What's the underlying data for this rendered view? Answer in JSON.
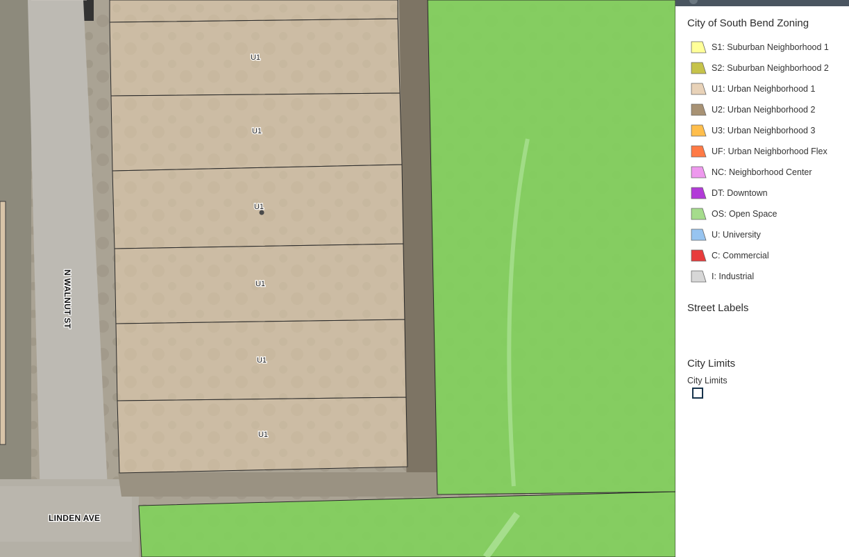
{
  "map": {
    "parcels": [
      {
        "label": "U1"
      },
      {
        "label": "U1"
      },
      {
        "label": "U1"
      },
      {
        "label": "U1"
      },
      {
        "label": "U1"
      },
      {
        "label": "U1"
      }
    ],
    "streets": {
      "walnut": "N WALNUT ST",
      "linden": "LINDEN AVE"
    },
    "colors": {
      "u1_fill": "#e8d2b0",
      "os_fill": "#7fd35a",
      "parcel_stroke": "#2a2a2a"
    }
  },
  "legend": {
    "layer_title": "City of South Bend Zoning",
    "items": [
      {
        "label": "S1: Suburban Neighborhood 1",
        "color": "#ffff99",
        "icon": "polygon-swatch-icon"
      },
      {
        "label": "S2: Suburban Neighborhood 2",
        "color": "#c6c34a",
        "icon": "polygon-swatch-icon"
      },
      {
        "label": "U1: Urban Neighborhood 1",
        "color": "#e8d2b8",
        "icon": "polygon-swatch-icon"
      },
      {
        "label": "U2: Urban Neighborhood 2",
        "color": "#a89274",
        "icon": "polygon-swatch-icon"
      },
      {
        "label": "U3: Urban Neighborhood 3",
        "color": "#ffbe4c",
        "icon": "polygon-swatch-icon"
      },
      {
        "label": "UF: Urban Neighborhood Flex",
        "color": "#ff7a45",
        "icon": "polygon-swatch-icon"
      },
      {
        "label": "NC: Neighborhood Center",
        "color": "#ee99ee",
        "icon": "polygon-swatch-icon"
      },
      {
        "label": "DT: Downtown",
        "color": "#b23ad8",
        "icon": "polygon-swatch-icon"
      },
      {
        "label": "OS: Open Space",
        "color": "#a5dc8c",
        "icon": "polygon-swatch-icon"
      },
      {
        "label": "U: University",
        "color": "#97c4f0",
        "icon": "polygon-swatch-icon"
      },
      {
        "label": "C: Commercial",
        "color": "#e83c3c",
        "icon": "polygon-swatch-icon"
      },
      {
        "label": "I: Industrial",
        "color": "#d7d7d7",
        "icon": "polygon-swatch-icon"
      }
    ],
    "street_labels_title": "Street Labels",
    "city_limits_title": "City Limits",
    "city_limits_sub": "City Limits"
  }
}
